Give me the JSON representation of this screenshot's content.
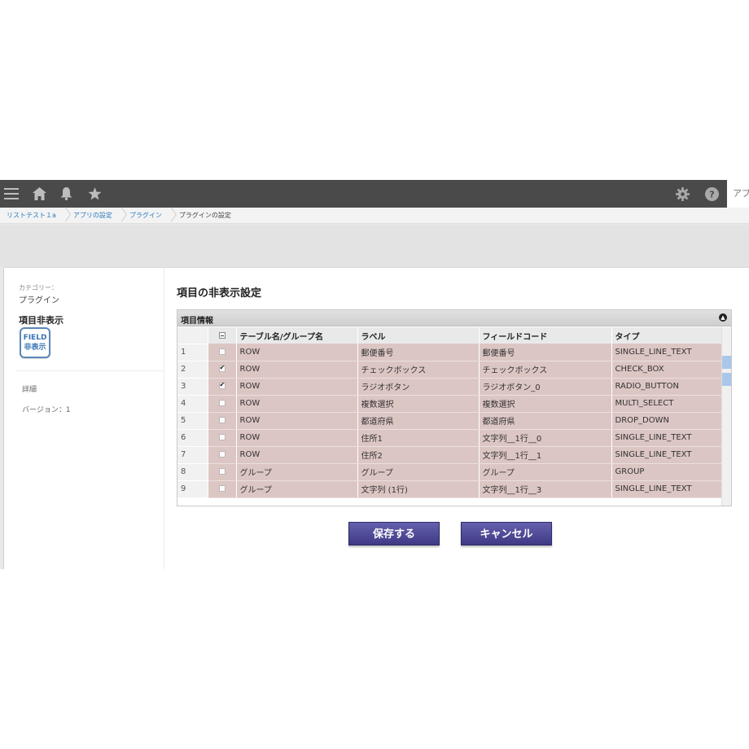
{
  "topbar": {
    "icons": [
      "menu-icon",
      "home-icon",
      "bell-icon",
      "star-icon",
      "gear-icon",
      "help-icon"
    ],
    "app_label": "アプリ"
  },
  "breadcrumb": [
    "リストテスト１a",
    "アプリの設定",
    "プラグイン",
    "プラグインの設定"
  ],
  "sidebar": {
    "category_label": "カテゴリー：",
    "category_value": "プラグイン",
    "plugin_name": "項目非表示",
    "plugin_icon_line1": "FIELD",
    "plugin_icon_line2": "非表示",
    "detail": "詳細",
    "version": "バージョン：1"
  },
  "main": {
    "title": "項目の非表示設定",
    "panel_title": "項目情報",
    "columns": [
      "テーブル名/グループ名",
      "ラベル",
      "フィールドコード",
      "タイプ"
    ],
    "rows": [
      {
        "n": "1",
        "checked": false,
        "table": "ROW",
        "label": "郵便番号",
        "code": "郵便番号",
        "type": "SINGLE_LINE_TEXT"
      },
      {
        "n": "2",
        "checked": true,
        "table": "ROW",
        "label": "チェックボックス",
        "code": "チェックボックス",
        "type": "CHECK_BOX"
      },
      {
        "n": "3",
        "checked": true,
        "table": "ROW",
        "label": "ラジオボタン",
        "code": "ラジオボタン_0",
        "type": "RADIO_BUTTON"
      },
      {
        "n": "4",
        "checked": false,
        "table": "ROW",
        "label": "複数選択",
        "code": "複数選択",
        "type": "MULTI_SELECT"
      },
      {
        "n": "5",
        "checked": false,
        "table": "ROW",
        "label": "都道府県",
        "code": "都道府県",
        "type": "DROP_DOWN"
      },
      {
        "n": "6",
        "checked": false,
        "table": "ROW",
        "label": "住所1",
        "code": "文字列__1行__0",
        "type": "SINGLE_LINE_TEXT"
      },
      {
        "n": "7",
        "checked": false,
        "table": "ROW",
        "label": "住所2",
        "code": "文字列__1行__1",
        "type": "SINGLE_LINE_TEXT"
      },
      {
        "n": "8",
        "checked": false,
        "table": "グループ",
        "label": "グループ",
        "code": "グループ",
        "type": "GROUP"
      },
      {
        "n": "9",
        "checked": false,
        "table": "グループ",
        "label": "文字列 (1行)",
        "code": "文字列__1行__3",
        "type": "SINGLE_LINE_TEXT"
      }
    ],
    "save_label": "保存する",
    "cancel_label": "キャンセル"
  },
  "colors": {
    "topbar": "#4a4a4a",
    "row_bg": "#dcc6c4",
    "button": "#4a4592",
    "link": "#2b7bc0",
    "selection": "#a9c7ea"
  }
}
